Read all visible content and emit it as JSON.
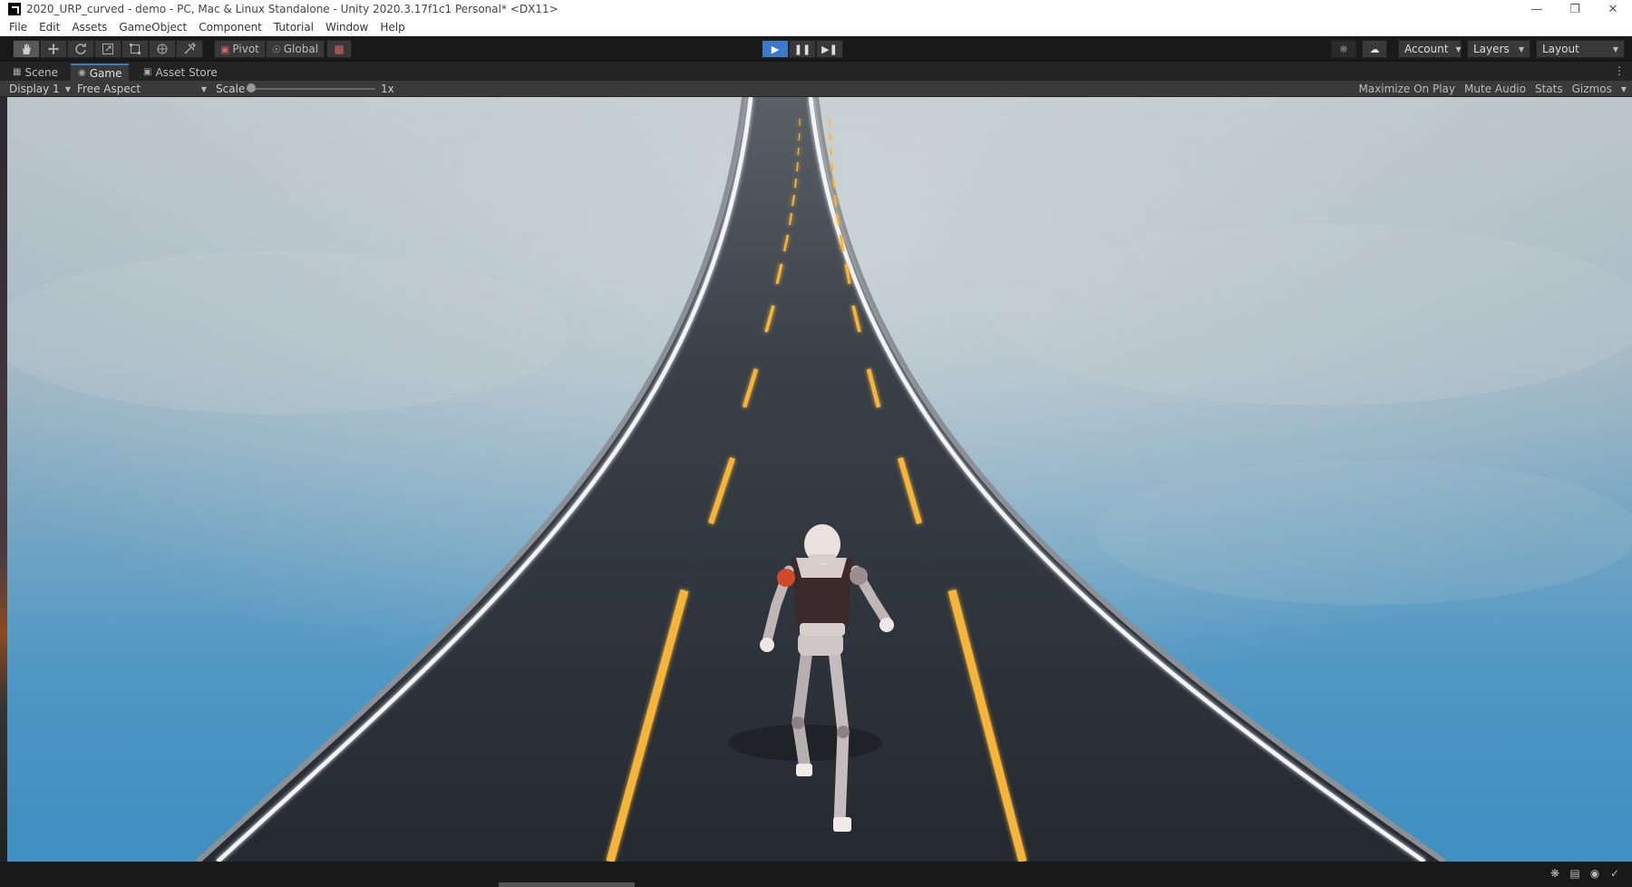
{
  "window": {
    "title": "2020_URP_curved - demo - PC, Mac & Linux Standalone - Unity 2020.3.17f1c1 Personal* <DX11>",
    "controls": [
      "minimize-icon",
      "restore-icon",
      "close-icon"
    ]
  },
  "menu": {
    "items": [
      "File",
      "Edit",
      "Assets",
      "GameObject",
      "Component",
      "Tutorial",
      "Window",
      "Help"
    ]
  },
  "toolbar": {
    "tools": [
      "hand-tool-icon",
      "move-tool-icon",
      "rotate-tool-icon",
      "scale-tool-icon",
      "rect-tool-icon",
      "transform-tool-icon",
      "custom-tool-icon"
    ],
    "pivot_label": "Pivot",
    "global_label": "Global",
    "play_state": "playing",
    "account_label": "Account",
    "layers_label": "Layers",
    "layout_label": "Layout",
    "accent_color": "#3b79c9"
  },
  "tabs": {
    "scene_label": "Scene",
    "game_label": "Game",
    "asset_store_label": "Asset Store",
    "active": "Game"
  },
  "game_view": {
    "display_label": "Display 1",
    "aspect_label": "Free Aspect",
    "scale_label": "Scale",
    "scale_value": "1x",
    "maximize_label": "Maximize On Play",
    "mute_label": "Mute Audio",
    "stats_label": "Stats",
    "gizmos_label": "Gizmos"
  },
  "scene": {
    "sky_top_color": "#b9c4c8",
    "sky_bottom_color": "#3f8fc0",
    "road_color": "#2b3037",
    "lane_color": "#f5b53a",
    "edge_color": "#f2f4f6"
  }
}
